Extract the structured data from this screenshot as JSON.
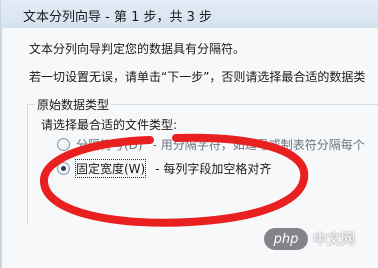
{
  "window": {
    "title": "文本分列向导 - 第 1 步，共 3 步"
  },
  "intro": {
    "line1": "文本分列向导判定您的数据具有分隔符。",
    "line2": "若一切设置无误，请单击“下一步”，否则请选择最合适的数据类"
  },
  "group": {
    "legend": "原始数据类型",
    "prompt": "请选择最合适的文件类型:",
    "options": [
      {
        "label": "分隔符号(D)",
        "description": "- 用分隔字符，如逗号或制表符分隔每个",
        "selected": false
      },
      {
        "label": "固定宽度(W)",
        "description": "- 每列字段加空格对齐",
        "selected": true
      }
    ]
  },
  "annotation": {
    "ellipse_color": "#e8201f"
  },
  "watermark": {
    "badge": "php",
    "text": "中文网"
  }
}
